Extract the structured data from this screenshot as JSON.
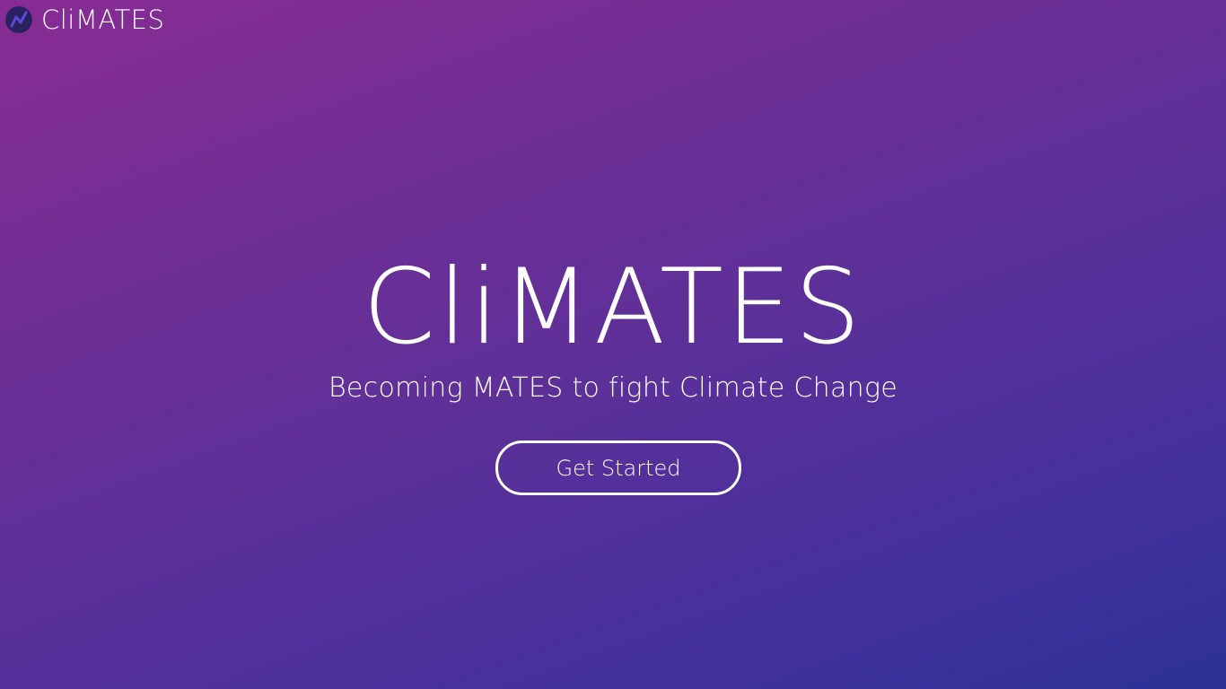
{
  "header": {
    "brand": "CliMATES",
    "logo_icon": "chart-line-icon"
  },
  "hero": {
    "title": "CliMATES",
    "subtitle": "Becoming MATES to fight Climate Change",
    "cta_label": "Get Started"
  },
  "colors": {
    "gradient_start": "#882c94",
    "gradient_end": "#2c3195",
    "logo_bg": "#2a2160",
    "text": "#ffffff"
  }
}
